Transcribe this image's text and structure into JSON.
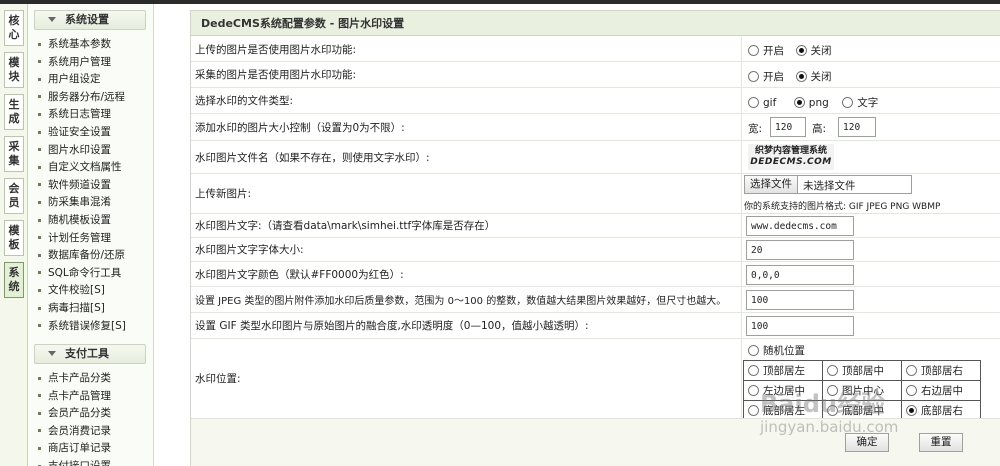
{
  "vtabs": [
    {
      "label": "核心",
      "active": false
    },
    {
      "label": "模块",
      "active": false
    },
    {
      "label": "生成",
      "active": false
    },
    {
      "label": "采集",
      "active": false
    },
    {
      "label": "会员",
      "active": false
    },
    {
      "label": "模板",
      "active": false
    },
    {
      "label": "系统",
      "active": true
    }
  ],
  "sidebar": {
    "sections": [
      {
        "title": "系统设置",
        "items": [
          "系统基本参数",
          "系统用户管理",
          "用户组设定",
          "服务器分布/远程",
          "系统日志管理",
          "验证安全设置",
          "图片水印设置",
          "自定义文档属性",
          "软件频道设置",
          "防采集串混淆",
          "随机模板设置",
          "计划任务管理",
          "数据库备份/还原",
          "SQL命令行工具",
          "文件校验[S]",
          "病毒扫描[S]",
          "系统错误修复[S]"
        ]
      },
      {
        "title": "支付工具",
        "items": [
          "点卡产品分类",
          "点卡产品管理",
          "会员产品分类",
          "会员消费记录",
          "商店订单记录",
          "支付接口设置"
        ]
      }
    ]
  },
  "main": {
    "title": "DedeCMS系统配置参数 - 图片水印设置",
    "rows": {
      "upload_wm": {
        "label": "上传的图片是否使用图片水印功能:",
        "options": [
          "开启",
          "关闭"
        ],
        "selected": 1
      },
      "collect_wm": {
        "label": "采集的图片是否使用图片水印功能:",
        "options": [
          "开启",
          "关闭"
        ],
        "selected": 1
      },
      "file_type": {
        "label": "选择水印的文件类型:",
        "options": [
          "gif",
          "png",
          "文字"
        ],
        "selected": 1
      },
      "size_limit": {
        "label": "添加水印的图片大小控制（设置为0为不限）:",
        "width_label": "宽:",
        "width_value": "120",
        "height_label": "高:",
        "height_value": "120"
      },
      "wm_image": {
        "label": "水印图片文件名（如果不存在，则使用文字水印）:",
        "logo_line1": "织梦内容管理系统",
        "logo_line2": "DEDECMS.COM"
      },
      "upload_new": {
        "label": "上传新图片:",
        "choose_button": "选择文件",
        "no_file": "未选择文件",
        "formats": "你的系统支持的图片格式: GIF JPEG PNG WBMP"
      },
      "wm_text": {
        "label": "水印图片文字:（请查看data\\mark\\simhei.ttf字体库是否存在）",
        "value": "www.dedecms.com"
      },
      "wm_font_size": {
        "label": "水印图片文字字体大小:",
        "value": "20"
      },
      "wm_color": {
        "label": "水印图片文字颜色（默认#FF0000为红色）:",
        "value": "0,0,0"
      },
      "jpeg_quality": {
        "label": "设置 JPEG 类型的图片附件添加水印后质量参数，范围为 0～100 的整数，数值越大结果图片效果越好，但尺寸也越大。",
        "value": "100"
      },
      "gif_opacity": {
        "label": "设置 GIF 类型水印图片与原始图片的融合度,水印透明度（0—100，值越小越透明）:",
        "value": "100"
      },
      "position": {
        "label": "水印位置:",
        "random_label": "随机位置",
        "grid": [
          [
            "顶部居左",
            "顶部居中",
            "顶部居右"
          ],
          [
            "左边居中",
            "图片中心",
            "右边居中"
          ],
          [
            "底部居左",
            "底部居中",
            "底部居右"
          ]
        ],
        "selected": "底部居右"
      }
    },
    "buttons": {
      "confirm": "确定",
      "reset": "重置"
    }
  },
  "watermark": {
    "line1": "Baidu经验",
    "line2": "jingyan.baidu.com"
  }
}
